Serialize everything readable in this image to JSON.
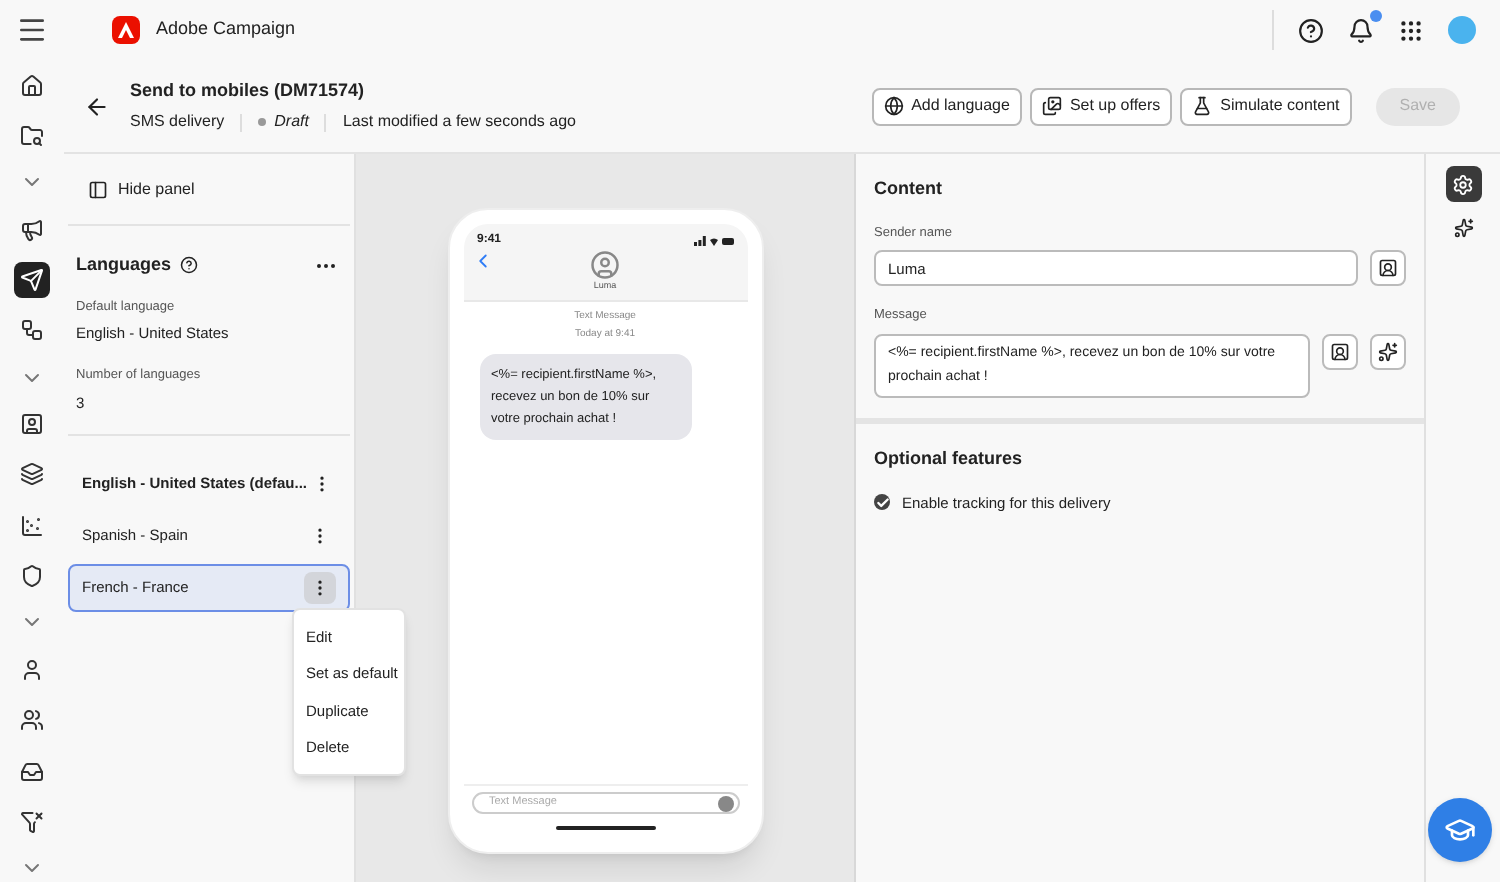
{
  "app": {
    "name": "Adobe Campaign",
    "notification": true
  },
  "rail": [
    {
      "kind": "icon",
      "selected": false
    },
    {
      "kind": "icon",
      "selected": false
    },
    {
      "kind": "chevron",
      "selected": false
    },
    {
      "kind": "icon",
      "selected": false
    },
    {
      "kind": "icon",
      "selected": true
    },
    {
      "kind": "icon",
      "selected": false
    },
    {
      "kind": "chevron",
      "selected": false
    },
    {
      "kind": "icon",
      "selected": false
    },
    {
      "kind": "icon",
      "selected": false
    },
    {
      "kind": "icon",
      "selected": false
    },
    {
      "kind": "icon",
      "selected": false
    },
    {
      "kind": "chevron",
      "selected": false
    },
    {
      "kind": "icon",
      "selected": false
    },
    {
      "kind": "icon",
      "selected": false
    },
    {
      "kind": "icon",
      "selected": false
    },
    {
      "kind": "icon",
      "selected": false
    },
    {
      "kind": "chevron",
      "selected": false
    }
  ],
  "header": {
    "title": "Send to mobiles (DM71574)",
    "type": "SMS delivery",
    "status": "Draft",
    "modified": "Last modified a few seconds ago",
    "buttons": [
      {
        "label": "Add language",
        "disabled": false
      },
      {
        "label": "Set up offers",
        "disabled": false
      },
      {
        "label": "Simulate content",
        "disabled": false
      },
      {
        "label": "Save",
        "disabled": true
      }
    ]
  },
  "panel": {
    "hide": "Hide panel",
    "title": "Languages",
    "default_label": "Default language",
    "default_value": "English - United States",
    "count_label": "Number of languages",
    "count_value": "3",
    "languages": [
      {
        "label": "English - United States (defau...",
        "default": true,
        "selected": false
      },
      {
        "label": "Spanish - Spain",
        "default": false,
        "selected": false
      },
      {
        "label": "French - France",
        "default": false,
        "selected": true
      }
    ],
    "menu": [
      "Edit",
      "Set as default",
      "Duplicate",
      "Delete"
    ]
  },
  "phone": {
    "time": "9:41",
    "contact": "Luma",
    "meta": "Text Message",
    "date": "Today at 9:41",
    "bubble": "<%= recipient.firstName %>, recevez un bon de 10% sur votre prochain achat !",
    "placeholder": "Text Message"
  },
  "content": {
    "title": "Content",
    "sender_label": "Sender name",
    "sender": "Luma",
    "message_label": "Message",
    "message": "<%= recipient.firstName %>, recevez un bon de 10% sur votre prochain achat !"
  },
  "optional": {
    "title": "Optional features",
    "tracking": {
      "label": "Enable tracking for this delivery",
      "checked": true
    }
  }
}
